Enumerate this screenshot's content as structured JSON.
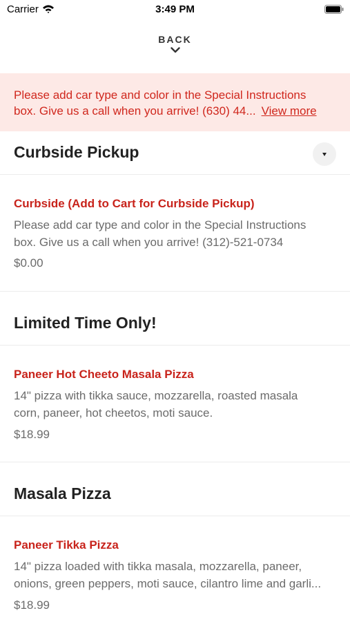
{
  "status_bar": {
    "carrier": "Carrier",
    "time": "3:49 PM"
  },
  "nav": {
    "back_label": "BACK"
  },
  "banner": {
    "line1": "Please add car type and color in the Special Instructions",
    "line2": "box. Give us a call when you arrive! (630) 44...",
    "link": "View more"
  },
  "sections": [
    {
      "title": "Curbside Pickup",
      "items": [
        {
          "name": "Curbside (Add to Cart for Curbside Pickup)",
          "desc_line1": "Please add car type and color in the Special Instructions",
          "desc_line2": "box. Give us a call when you arrive!  (312)-521-0734",
          "price": "$0.00"
        }
      ]
    },
    {
      "title": "Limited Time Only!",
      "items": [
        {
          "name": "Paneer Hot Cheeto Masala Pizza",
          "desc_line1": "14\" pizza with tikka sauce, mozzarella, roasted masala",
          "desc_line2": "corn, paneer, hot cheetos, moti sauce.",
          "price": "$18.99"
        }
      ]
    },
    {
      "title": "Masala Pizza",
      "items": [
        {
          "name": "Paneer Tikka Pizza",
          "desc_line1": "14\" pizza loaded with tikka masala, mozzarella, paneer,",
          "desc_line2": "onions, green peppers, moti sauce, cilantro lime and garli...",
          "price": "$18.99"
        }
      ]
    }
  ],
  "icons": {
    "wifi": "wifi-icon",
    "battery": "battery-icon",
    "back_chevron": "chevron-down-icon",
    "section_toggle": "caret-down-icon"
  },
  "colors": {
    "accent_red": "#c8231b",
    "banner_bg": "#fde9e6",
    "banner_text": "#d0271d",
    "body_text": "#6b6b6b"
  }
}
